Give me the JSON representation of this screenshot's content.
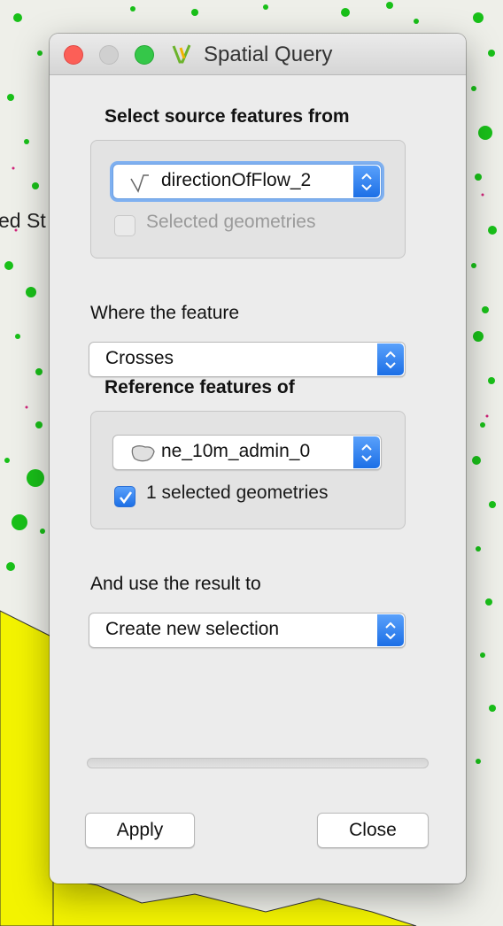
{
  "window": {
    "title": "Spatial Query"
  },
  "map": {
    "partial_label": "ed St"
  },
  "source": {
    "heading": "Select source features from",
    "layer": "directionOfFlow_2",
    "selected_geometries_label": "Selected geometries",
    "selected_geometries_checked": false
  },
  "predicate": {
    "label": "Where the feature",
    "value": "Crosses"
  },
  "reference": {
    "heading": "Reference features of",
    "layer": "ne_10m_admin_0",
    "selected_geometries_label": "1 selected geometries",
    "selected_geometries_checked": true
  },
  "result": {
    "label": "And use the result to",
    "value": "Create new selection"
  },
  "buttons": {
    "apply": "Apply",
    "close": "Close"
  },
  "colors": {
    "accent": "#1c6fe6",
    "map_points": "#19c019",
    "map_fill": "#f3f300"
  }
}
